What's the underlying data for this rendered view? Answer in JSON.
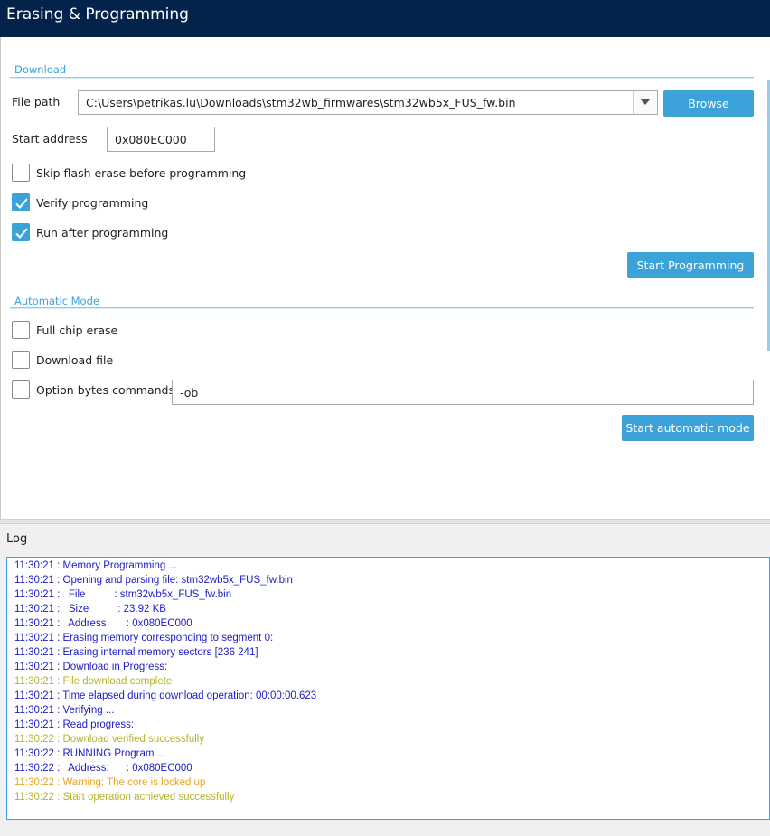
{
  "window": {
    "title": "Erasing & Programming"
  },
  "colors": {
    "titlebar": "#03234b",
    "accent": "#3ba3d9",
    "log_info": "#1c1cc8",
    "log_success": "#b3b42d",
    "log_warning": "#e8a21f"
  },
  "download": {
    "section_title": "Download",
    "file_path_label": "File path",
    "file_path_value": "C:\\Users\\petrikas.lu\\Downloads\\stm32wb_firmwares\\stm32wb5x_FUS_fw.bin",
    "browse_label": "Browse",
    "start_address_label": "Start address",
    "start_address_value": "0x080EC000",
    "skip_erase_label": "Skip flash erase before programming",
    "skip_erase_checked": false,
    "verify_label": "Verify programming",
    "verify_checked": true,
    "run_after_label": "Run after programming",
    "run_after_checked": true,
    "start_programming_label": "Start Programming"
  },
  "automatic": {
    "section_title": "Automatic Mode",
    "full_chip_erase_label": "Full chip erase",
    "full_chip_erase_checked": false,
    "download_file_label": "Download file",
    "download_file_checked": false,
    "option_bytes_label": "Option bytes commands",
    "option_bytes_checked": false,
    "option_bytes_value": "-ob",
    "start_automatic_label": "Start automatic mode"
  },
  "log": {
    "title": "Log",
    "lines": [
      {
        "text": "11:30:21 : Memory Programming ...",
        "level": "info"
      },
      {
        "text": "11:30:21 : Opening and parsing file: stm32wb5x_FUS_fw.bin",
        "level": "info"
      },
      {
        "text": "11:30:21 :   File          : stm32wb5x_FUS_fw.bin",
        "level": "info"
      },
      {
        "text": "11:30:21 :   Size          : 23.92 KB",
        "level": "info"
      },
      {
        "text": "11:30:21 :   Address       : 0x080EC000",
        "level": "info"
      },
      {
        "text": "11:30:21 : Erasing memory corresponding to segment 0:",
        "level": "info"
      },
      {
        "text": "11:30:21 : Erasing internal memory sectors [236 241]",
        "level": "info"
      },
      {
        "text": "11:30:21 : Download in Progress:",
        "level": "info"
      },
      {
        "text": "11:30:21 : File download complete",
        "level": "success"
      },
      {
        "text": "11:30:21 : Time elapsed during download operation: 00:00:00.623",
        "level": "info"
      },
      {
        "text": "11:30:21 : Verifying ...",
        "level": "info"
      },
      {
        "text": "11:30:21 : Read progress:",
        "level": "info"
      },
      {
        "text": "11:30:22 : Download verified successfully",
        "level": "success"
      },
      {
        "text": "11:30:22 : RUNNING Program ...",
        "level": "info"
      },
      {
        "text": "11:30:22 :   Address:      : 0x080EC000",
        "level": "info"
      },
      {
        "text": "11:30:22 : Warning: The core is locked up",
        "level": "warning"
      },
      {
        "text": "11:30:22 : Start operation achieved successfully",
        "level": "success"
      }
    ]
  }
}
